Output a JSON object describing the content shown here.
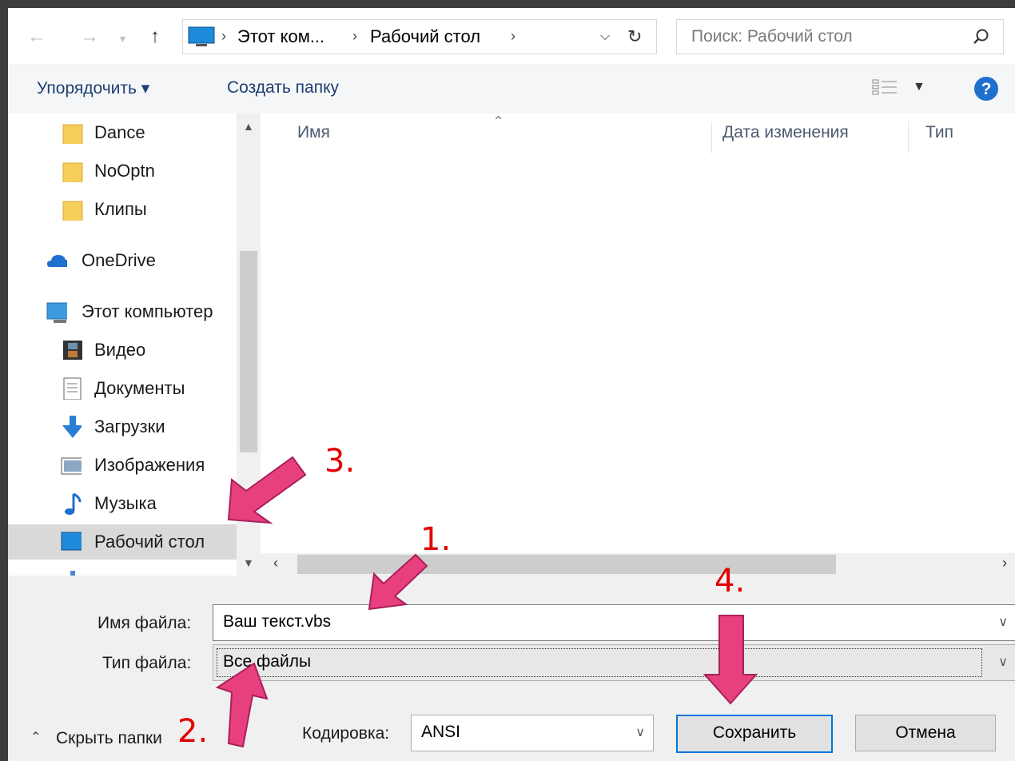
{
  "address_bar": {
    "crumbs": [
      "Этот ком...",
      "Рабочий стол"
    ]
  },
  "search": {
    "placeholder": "Поиск: Рабочий стол"
  },
  "toolbar": {
    "organize": "Упорядочить ▾",
    "new_folder": "Создать папку"
  },
  "nav_pane": {
    "items": [
      {
        "label": "Dance",
        "icon": "folder-icon"
      },
      {
        "label": "NoOptn",
        "icon": "folder-icon"
      },
      {
        "label": "Клипы",
        "icon": "folder-icon"
      },
      {
        "label": "OneDrive",
        "icon": "cloud-icon"
      },
      {
        "label": "Этот компьютер",
        "icon": "computer-icon"
      },
      {
        "label": "Видео",
        "icon": "video-icon"
      },
      {
        "label": "Документы",
        "icon": "document-icon"
      },
      {
        "label": "Загрузки",
        "icon": "download-icon"
      },
      {
        "label": "Изображения",
        "icon": "image-icon"
      },
      {
        "label": "Музыка",
        "icon": "music-icon"
      },
      {
        "label": "Рабочий стол",
        "icon": "desktop-icon",
        "selected": true
      }
    ]
  },
  "file_list": {
    "columns": [
      "Имя",
      "Дата изменения",
      "Тип"
    ]
  },
  "form": {
    "filename_label": "Имя файла:",
    "filename_value": "Ваш текст.vbs",
    "filetype_label": "Тип файла:",
    "filetype_value": "Все файлы",
    "encoding_label": "Кодировка:",
    "encoding_value": "ANSI"
  },
  "buttons": {
    "hide_folders": "Скрыть папки",
    "save": "Сохранить",
    "cancel": "Отмена"
  },
  "annotations": [
    "1.",
    "2.",
    "3.",
    "4."
  ],
  "colors": {
    "arrow": "#e8407f",
    "annotation_text": "#e30000",
    "selection": "#d9d9d9",
    "accent": "#0078d7"
  }
}
